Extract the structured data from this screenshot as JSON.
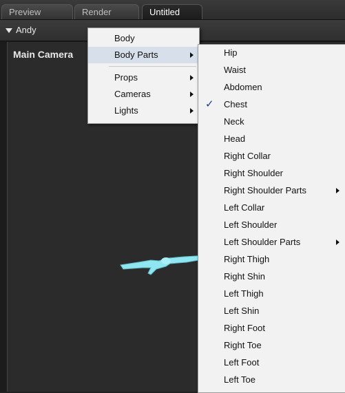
{
  "tabs": [
    {
      "label": "Preview"
    },
    {
      "label": "Render"
    },
    {
      "label": "Untitled"
    }
  ],
  "figure_selector": {
    "label": "Andy"
  },
  "viewport": {
    "camera_label": "Main Camera"
  },
  "menu_main": {
    "items": [
      {
        "label": "Body"
      },
      {
        "label": "Body Parts",
        "submenu": true,
        "highlighted": true
      },
      {
        "label": "Props",
        "submenu": true
      },
      {
        "label": "Cameras",
        "submenu": true
      },
      {
        "label": "Lights",
        "submenu": true
      }
    ]
  },
  "menu_body_parts": {
    "checked_item": "Chest",
    "items": [
      {
        "label": "Hip"
      },
      {
        "label": "Waist"
      },
      {
        "label": "Abdomen"
      },
      {
        "label": "Chest",
        "checked": true
      },
      {
        "label": "Neck"
      },
      {
        "label": "Head"
      },
      {
        "label": "Right Collar"
      },
      {
        "label": "Right Shoulder"
      },
      {
        "label": "Right Shoulder Parts",
        "submenu": true
      },
      {
        "label": "Left Collar"
      },
      {
        "label": "Left Shoulder"
      },
      {
        "label": "Left Shoulder Parts",
        "submenu": true
      },
      {
        "label": "Right Thigh"
      },
      {
        "label": "Right Shin"
      },
      {
        "label": "Left Thigh"
      },
      {
        "label": "Left Shin"
      },
      {
        "label": "Right Foot"
      },
      {
        "label": "Right Toe"
      },
      {
        "label": "Left Foot"
      },
      {
        "label": "Left Toe"
      }
    ]
  },
  "colors": {
    "figure": "#8fe6f0",
    "menu_bg": "#f2f2f2",
    "highlight": "#d6dfea"
  }
}
